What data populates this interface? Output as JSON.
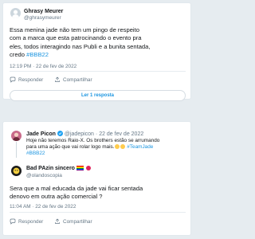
{
  "tweet1": {
    "author_name": "Ghrasy Meurer",
    "author_handle": "@ghrasymeurer",
    "text_lines": [
      "Essa menina jade não tem um pingo de respeito",
      "com a marca que esta patrocinando o evento pra",
      "eles, todos interagindo nas Publi e a bunita sentada,",
      "credo"
    ],
    "hashtag": "#BBB22",
    "timestamp": "12:19 PM · 22 de fev de 2022",
    "reply_label": "Responder",
    "share_label": "Compartilhar",
    "show_replies_label": "Ler 1 resposta"
  },
  "tweet2": {
    "author_name": "Jade Picon",
    "author_handle": "@jadepicon",
    "date": "22 de fev de 2022",
    "verified": true,
    "text_lines": [
      "Hoje não teremos Raio-X. Os brothers estão se arrumando",
      "para uma ação que vai rolar logo mais."
    ],
    "hashtags": [
      "#TeamJade",
      "#BBB22"
    ]
  },
  "tweet3": {
    "author_name": "Bad PAzin sincero",
    "author_handle": "@olandoscopia",
    "text_lines": [
      "Sera que a mal educada da jade vai ficar sentada",
      "denovo em outra ação comercial ?"
    ],
    "timestamp": "11:04 AM · 22 de fev de 2022",
    "reply_label": "Responder",
    "share_label": "Compartilhar"
  },
  "colors": {
    "link_blue": "#1b95e0",
    "muted_gray": "#657786",
    "background": "#e6ecf0"
  },
  "icons": [
    "avatar",
    "reply-icon",
    "share-icon",
    "verified-badge-icon",
    "emoji-icon",
    "rainbow-flag-icon"
  ]
}
